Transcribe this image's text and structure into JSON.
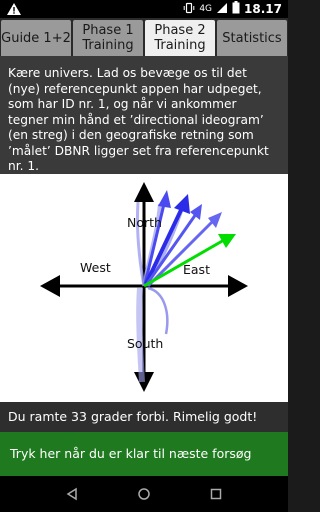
{
  "status_bar": {
    "network": "4G",
    "time": "18.17"
  },
  "tabs": [
    {
      "label": "Guide 1+2",
      "active": false
    },
    {
      "label": "Phase 1 Training",
      "active": false
    },
    {
      "label": "Phase 2 Training",
      "active": true
    },
    {
      "label": "Statistics",
      "active": false
    }
  ],
  "message": "Kære univers. Lad os bevæge os til det (nye) referencepunkt appen har udpeget, som har ID nr. 1, og når vi ankommer tegner min hånd et ’directional ideogram’ (en streg) i den geografiske retning som ’målet’ DBNR ligger set fra referencepunkt nr. 1.",
  "compass": {
    "north": "North",
    "south": "South",
    "east": "East",
    "west": "West"
  },
  "result": "Du ramte 33 grader forbi. Rimelig godt!",
  "next_button": "Tryk her når du er klar til næste forsøg",
  "colors": {
    "target_arrow": "#00dd00",
    "guess_arrows": "#3333ee",
    "sketch": "#7777ee",
    "button_bg": "#1f7a1f"
  }
}
